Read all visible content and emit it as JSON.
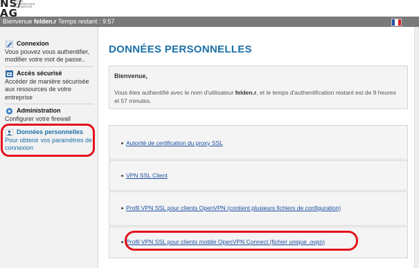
{
  "header": {
    "logo_text": "NS/\nAG",
    "logo_subtext": "ÉCOLE INFORMATIQUE AUTOMATION",
    "welcome_prefix": "Bienvenue ",
    "username": "felden.r",
    "time_label": " Temps restant : ",
    "time_remaining": "9:57",
    "language_flag": "flag-fr-icon"
  },
  "sidebar": {
    "items": [
      {
        "icon": "pencil-icon",
        "title": "Connexion",
        "desc": "Vous pouvez vous authentifier, modifier votre mot de passe.."
      },
      {
        "icon": "secure-access-icon",
        "title": "Accès sécurisé",
        "desc": "Accéder de manière sécurisée aux ressources de votre entreprise"
      },
      {
        "icon": "admin-gear-icon",
        "title": "Administration",
        "desc": "Configurer votre firewall"
      },
      {
        "icon": "personal-data-icon",
        "title": "Données personnelles",
        "desc": "Pour obtenir vos paramètres de connexion"
      }
    ],
    "active_index": 3
  },
  "main": {
    "title": "DONNÉES PERSONNELLES",
    "welcome": {
      "heading": "Bienvenue,",
      "text_1": "Vous êtes authentifié avec le nom d'utilisateur ",
      "username": "felden.r",
      "text_2": ", et le temps d'authentification restant est de 9 heures et 57 minutes."
    },
    "links": [
      "Autorité de certification du proxy SSL",
      "VPN SSL Client",
      "Profil VPN SSL pour clients OpenVPN (contient plusieurs fichiers de configuration)",
      "Profil VPN SSL pour clients mobile OpenVPN Connect (fichier unique .ovpn)"
    ]
  },
  "colors": {
    "accent_blue": "#1a6ea8",
    "link_blue": "#1a4fa0",
    "highlight_red": "#e2101a",
    "status_bar": "#7a7a7a"
  }
}
